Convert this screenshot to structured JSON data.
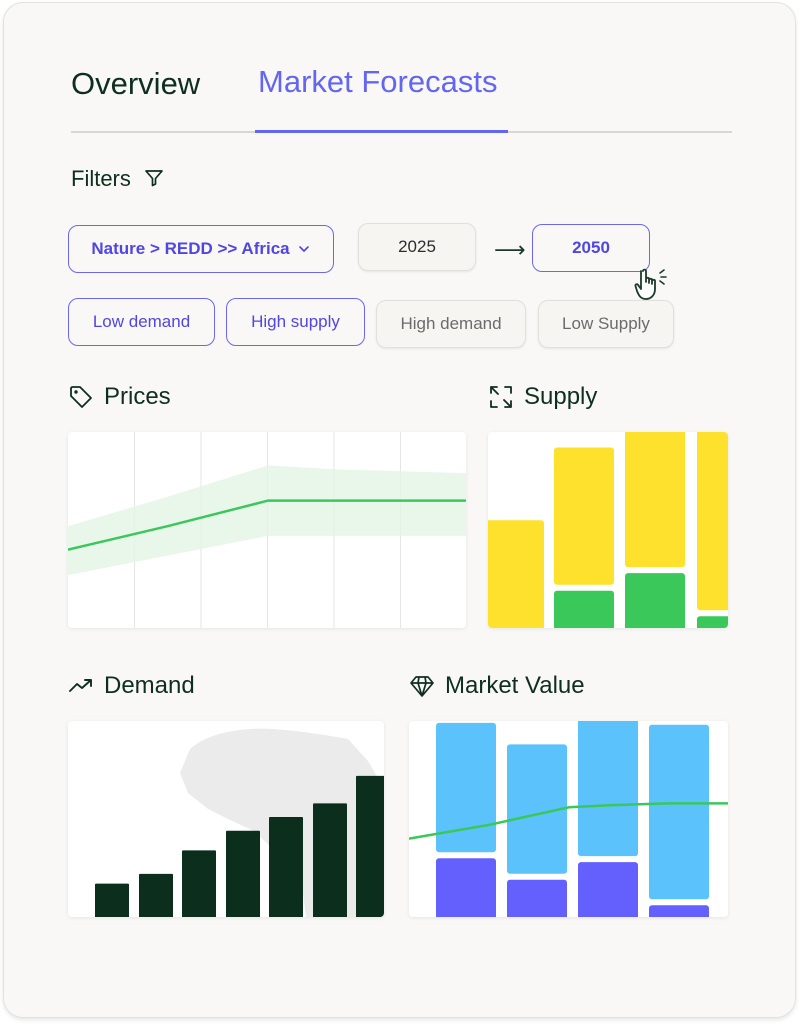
{
  "tabs": [
    {
      "label": "Overview",
      "active": false
    },
    {
      "label": "Market Forecasts",
      "active": true
    }
  ],
  "filters": {
    "label": "Filters",
    "category_value": "Nature > REDD >> Africa",
    "year_from": "2025",
    "year_to": "2050",
    "chips": [
      {
        "label": "Low demand",
        "selected": true
      },
      {
        "label": "High supply",
        "selected": true
      },
      {
        "label": "High demand",
        "selected": false
      },
      {
        "label": "Low Supply",
        "selected": false
      }
    ]
  },
  "sections": {
    "prices": "Prices",
    "supply": "Supply",
    "demand": "Demand",
    "market_value": "Market Value"
  },
  "icons": {
    "filter": "filter-icon",
    "prices": "tag-icon",
    "supply": "expand-arrows-icon",
    "demand": "trending-up-icon",
    "market_value": "diamond-icon",
    "cursor": "hand-pointer-icon",
    "dropdown": "chevron-down-icon",
    "range_arrow": "arrow-right-icon"
  },
  "colors": {
    "accent": "#6366f1",
    "dark_green": "#0b2e1d",
    "green": "#3ac85a",
    "yellow": "#fde12d",
    "light_blue": "#5bc2fc",
    "purple": "#6360fd"
  },
  "chart_data": [
    {
      "name": "prices",
      "type": "line",
      "x": [
        0,
        1,
        2,
        3,
        4,
        5
      ],
      "series": [
        {
          "values": [
            0.4,
            0.52,
            0.65,
            0.65,
            0.65,
            0.65
          ]
        }
      ],
      "band": {
        "lower": [
          0.27,
          0.37,
          0.47,
          0.47,
          0.47,
          0.47
        ],
        "upper": [
          0.52,
          0.67,
          0.83,
          0.81,
          0.8,
          0.79
        ]
      },
      "ylim": [
        0,
        1
      ],
      "grid": true
    },
    {
      "name": "supply",
      "type": "bar",
      "stacked": true,
      "categories": [
        "1",
        "2",
        "3",
        "4"
      ],
      "series": [
        {
          "values": [
            0,
            0.19,
            0.28,
            0.06
          ]
        },
        {
          "values": [
            0.55,
            0.7,
            0.75,
            0.94
          ]
        }
      ],
      "ylim": [
        0,
        1
      ]
    },
    {
      "name": "demand",
      "type": "bar",
      "categories": [
        "1",
        "2",
        "3",
        "4",
        "5",
        "6",
        "7"
      ],
      "values": [
        0.17,
        0.22,
        0.34,
        0.44,
        0.51,
        0.58,
        0.72
      ],
      "ylim": [
        0,
        1
      ]
    },
    {
      "name": "market_value",
      "type": "bar",
      "stacked": true,
      "categories": [
        "1",
        "2",
        "3",
        "4"
      ],
      "series": [
        {
          "values": [
            0.3,
            0.19,
            0.28,
            0.06
          ]
        },
        {
          "values": [
            0.66,
            0.66,
            0.7,
            0.89
          ]
        }
      ],
      "line": [
        0.4,
        0.47,
        0.56,
        0.57,
        0.58,
        0.58
      ],
      "ylim": [
        0,
        1
      ]
    }
  ]
}
